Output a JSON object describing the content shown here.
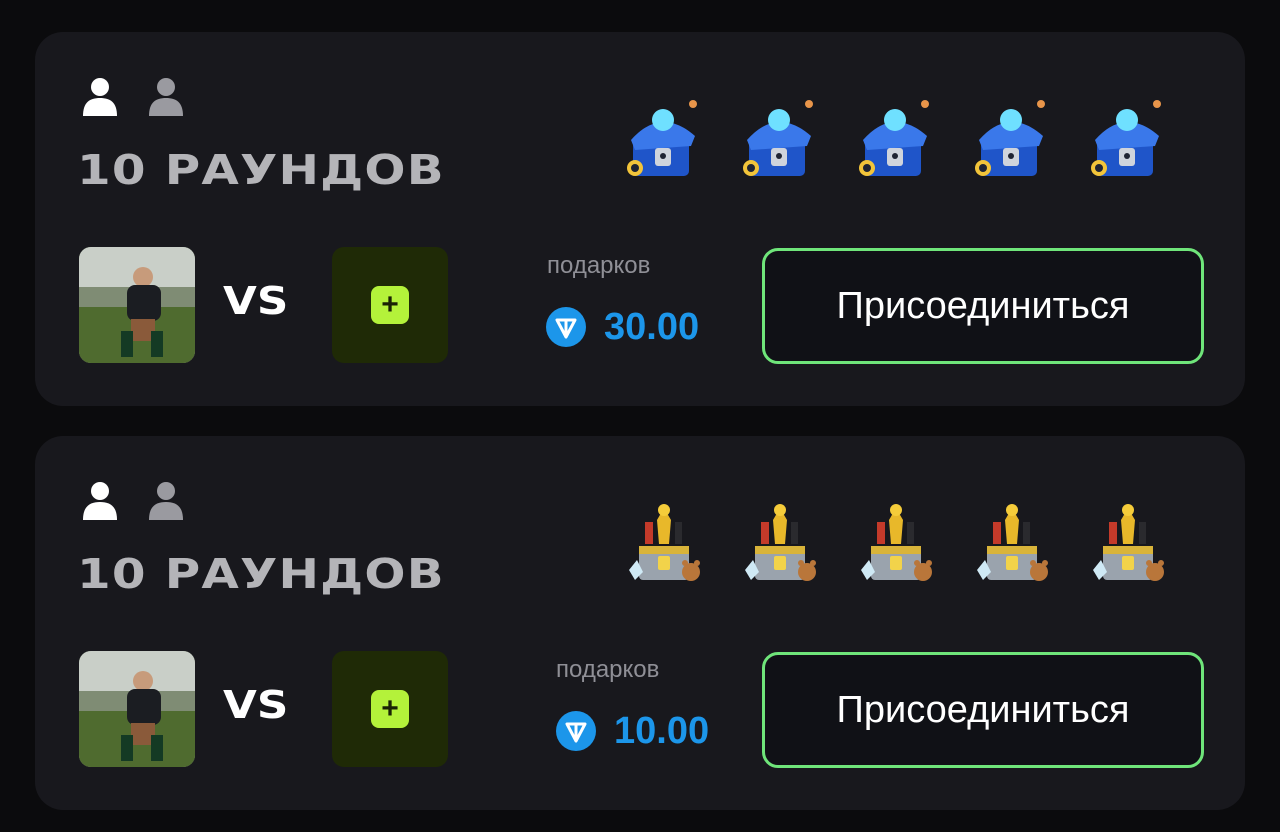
{
  "lobbies": [
    {
      "title": "10 РАУНДОВ",
      "players": {
        "filled": 1,
        "total": 2
      },
      "chests": [
        "blue-chest-icon",
        "blue-chest-icon",
        "blue-chest-icon",
        "blue-chest-icon",
        "blue-chest-icon"
      ],
      "vs_label": "VS",
      "prize_label": "подарков",
      "prize_value": "30.00",
      "join_label": "Присоединиться"
    },
    {
      "title": "10 РАУНДОВ",
      "players": {
        "filled": 1,
        "total": 2
      },
      "chests": [
        "gold-chest-icon",
        "gold-chest-icon",
        "gold-chest-icon",
        "gold-chest-icon",
        "gold-chest-icon"
      ],
      "vs_label": "VS",
      "prize_label": "подарков",
      "prize_value": "10.00",
      "join_label": "Присоединиться"
    }
  ],
  "colors": {
    "background": "#0b0b0d",
    "card": "#18181d",
    "accent_green": "#b4f23a",
    "button_border": "#6fe57a",
    "ton_blue": "#1c96ea"
  },
  "icons": {
    "player_filled": "user-icon",
    "player_empty": "user-icon",
    "currency": "ton-icon",
    "join_slot": "plus-icon"
  }
}
